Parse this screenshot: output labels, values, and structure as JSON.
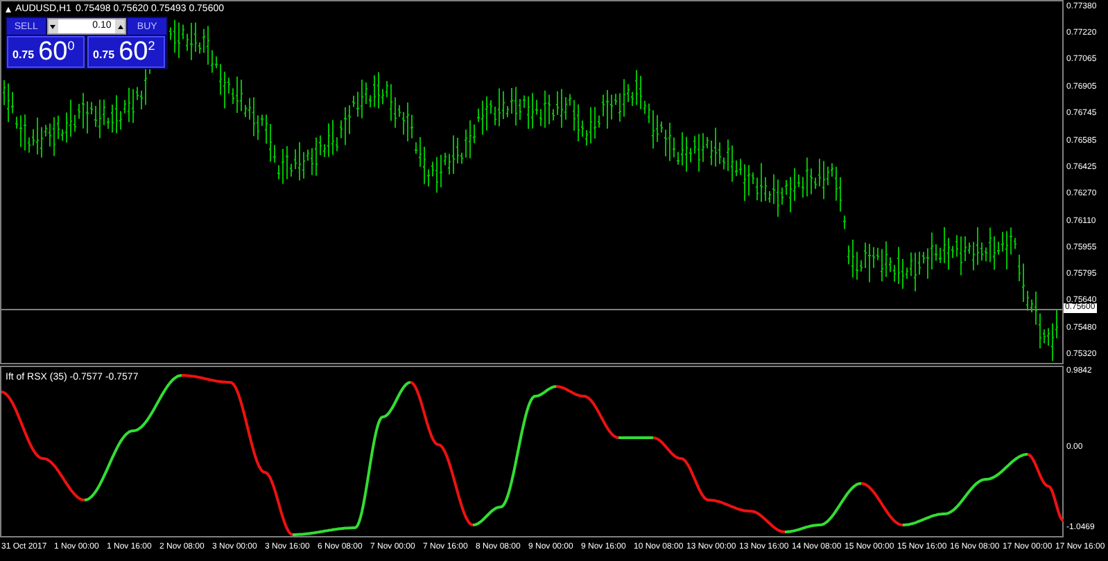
{
  "header": {
    "symbol": "AUDUSD,H1",
    "quotes": "0.75498 0.75620 0.75493 0.75600"
  },
  "trade_panel": {
    "sell": {
      "label": "SELL",
      "prefix": "0.75",
      "main": "60",
      "sup": "0"
    },
    "lot": "0.10",
    "buy": {
      "label": "BUY",
      "prefix": "0.75",
      "main": "60",
      "sup": "2"
    }
  },
  "price_axis": [
    "0.77380",
    "0.77220",
    "0.77065",
    "0.76905",
    "0.76745",
    "0.76585",
    "0.76425",
    "0.76270",
    "0.76110",
    "0.75955",
    "0.75795",
    "0.75640",
    "0.75480",
    "0.75320"
  ],
  "current_price": "0.75600",
  "indicator": {
    "title": "Ift of RSX (35) -0.7577 -0.7577",
    "axis": [
      "0.9842",
      "0.00",
      "-1.0469"
    ]
  },
  "time_axis": [
    "31 Oct 2017",
    "1 Nov 00:00",
    "1 Nov 16:00",
    "2 Nov 08:00",
    "3 Nov 00:00",
    "3 Nov 16:00",
    "6 Nov 08:00",
    "7 Nov 00:00",
    "7 Nov 16:00",
    "8 Nov 08:00",
    "9 Nov 00:00",
    "9 Nov 16:00",
    "10 Nov 08:00",
    "13 Nov 00:00",
    "13 Nov 16:00",
    "14 Nov 08:00",
    "15 Nov 00:00",
    "15 Nov 16:00",
    "16 Nov 08:00",
    "17 Nov 00:00",
    "17 Nov 16:00"
  ]
}
